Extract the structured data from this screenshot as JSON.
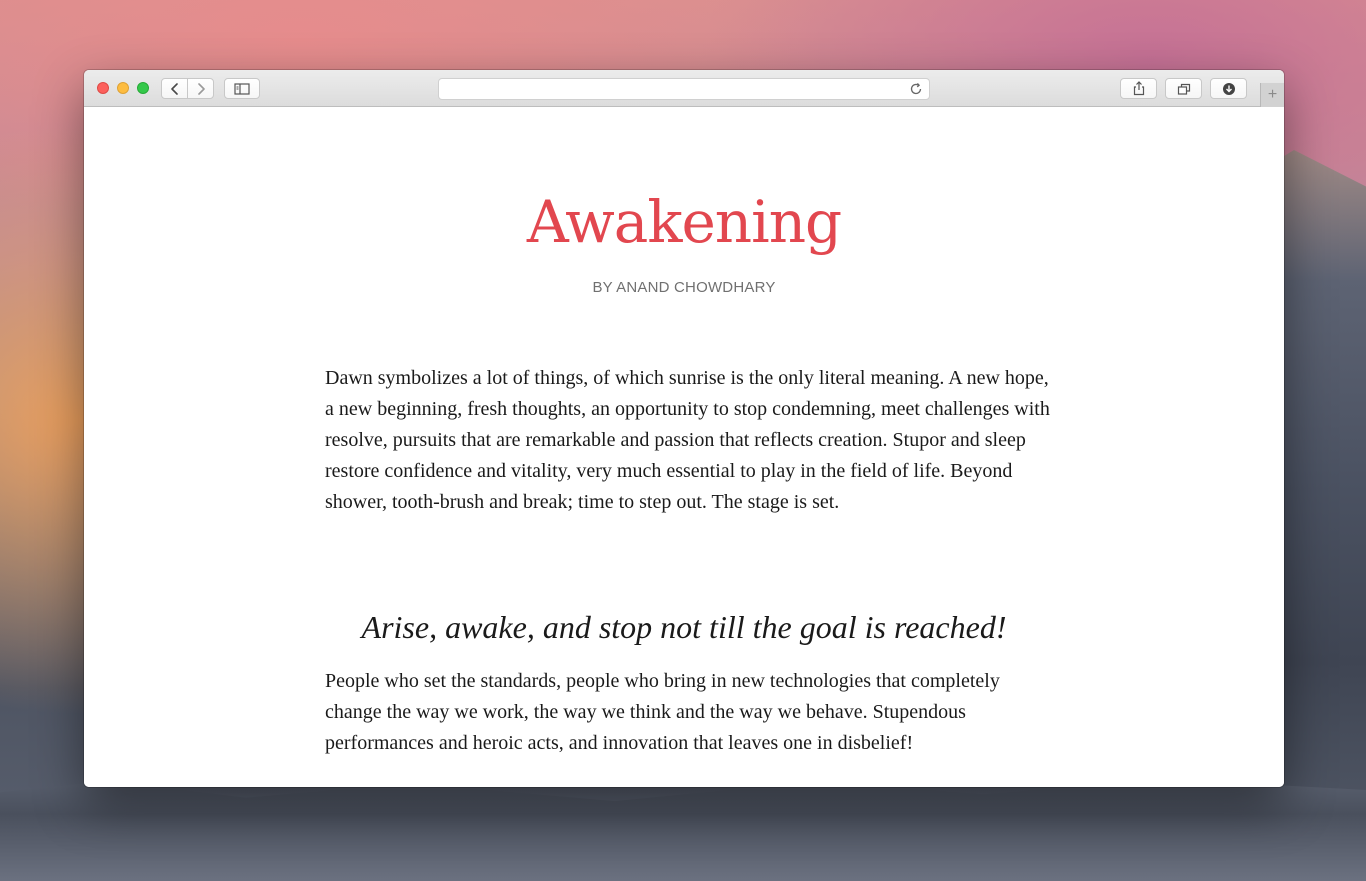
{
  "window": {
    "address_text": "",
    "new_tab_label": "+"
  },
  "icons": {
    "back": "chevron-left-icon",
    "forward": "chevron-right-icon",
    "sidebar": "sidebar-icon",
    "reload": "reload-icon",
    "share": "share-icon",
    "tabs": "tabs-overview-icon",
    "download": "download-icon"
  },
  "colors": {
    "title": "#e2474f",
    "byline": "#707070",
    "body_text": "#1a1a1a",
    "traffic_close": "#fc605c",
    "traffic_minimize": "#fdbc40",
    "traffic_zoom": "#34c84a"
  },
  "article": {
    "title": "Awakening",
    "byline": "BY ANAND CHOWDHARY",
    "paragraph_1": "Dawn symbolizes a lot of things, of which sunrise is the only literal meaning. A new hope, a new beginning, fresh thoughts, an opportunity to stop condemning, meet challenges with resolve, pursuits that are remarkable and passion that reflects creation. Stupor and sleep restore confidence and vitality, very much essential to play in the field of life. Beyond shower, tooth-brush and break; time to step out. The stage is set.",
    "quote": "Arise, awake, and stop not till the goal is reached!",
    "paragraph_2": "People who set the standards, people who bring in new technologies that completely change the way we work, the way we think and the way we behave. Stupendous performances and heroic acts, and innovation that leaves one in disbelief!"
  }
}
